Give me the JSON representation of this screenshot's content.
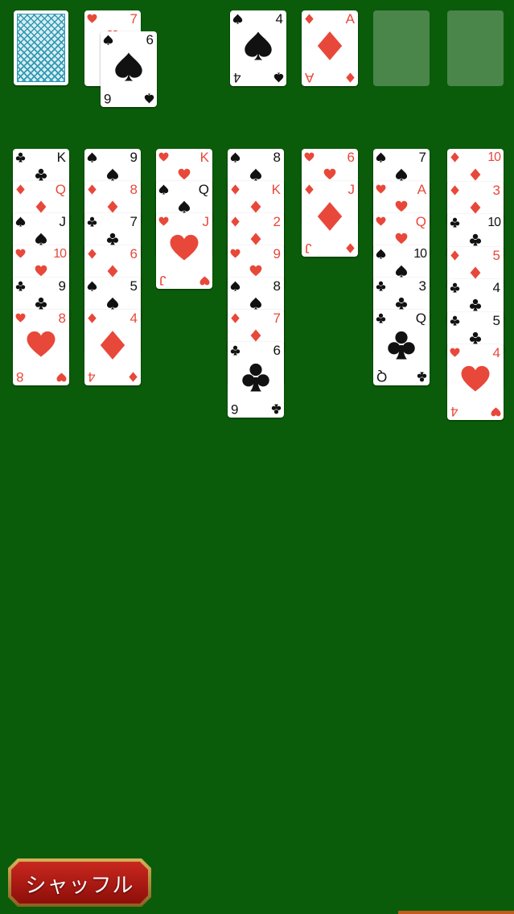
{
  "colors": {
    "felt": "#0a5c0a",
    "red_suit": "#e8483a",
    "black_suit": "#111111",
    "slot": "#4a854a"
  },
  "stock": {
    "face": "down"
  },
  "waste": [
    {
      "rank": "7",
      "suit": "hearts"
    },
    {
      "rank": "6",
      "suit": "spades"
    }
  ],
  "foundations": [
    {
      "rank": "4",
      "suit": "spades"
    },
    {
      "rank": "A",
      "suit": "diamonds"
    },
    null,
    null
  ],
  "tableau": [
    [
      {
        "rank": "K",
        "suit": "clubs"
      },
      {
        "rank": "Q",
        "suit": "diamonds"
      },
      {
        "rank": "J",
        "suit": "spades"
      },
      {
        "rank": "10",
        "suit": "hearts"
      },
      {
        "rank": "9",
        "suit": "clubs"
      },
      {
        "rank": "8",
        "suit": "hearts"
      }
    ],
    [
      {
        "rank": "9",
        "suit": "spades"
      },
      {
        "rank": "8",
        "suit": "diamonds"
      },
      {
        "rank": "7",
        "suit": "clubs"
      },
      {
        "rank": "6",
        "suit": "diamonds"
      },
      {
        "rank": "5",
        "suit": "spades"
      },
      {
        "rank": "4",
        "suit": "diamonds"
      }
    ],
    [
      {
        "rank": "K",
        "suit": "hearts"
      },
      {
        "rank": "Q",
        "suit": "spades"
      },
      {
        "rank": "J",
        "suit": "hearts"
      }
    ],
    [
      {
        "rank": "8",
        "suit": "spades"
      },
      {
        "rank": "K",
        "suit": "diamonds"
      },
      {
        "rank": "2",
        "suit": "diamonds"
      },
      {
        "rank": "9",
        "suit": "hearts"
      },
      {
        "rank": "8",
        "suit": "spades"
      },
      {
        "rank": "7",
        "suit": "diamonds"
      },
      {
        "rank": "6",
        "suit": "clubs"
      }
    ],
    [
      {
        "rank": "6",
        "suit": "hearts"
      },
      {
        "rank": "J",
        "suit": "diamonds"
      }
    ],
    [
      {
        "rank": "7",
        "suit": "spades"
      },
      {
        "rank": "A",
        "suit": "hearts"
      },
      {
        "rank": "Q",
        "suit": "hearts"
      },
      {
        "rank": "10",
        "suit": "spades"
      },
      {
        "rank": "3",
        "suit": "clubs"
      },
      {
        "rank": "Q",
        "suit": "clubs"
      }
    ],
    [
      {
        "rank": "10",
        "suit": "diamonds"
      },
      {
        "rank": "3",
        "suit": "diamonds"
      },
      {
        "rank": "10",
        "suit": "clubs"
      },
      {
        "rank": "5",
        "suit": "diamonds"
      },
      {
        "rank": "4",
        "suit": "clubs"
      },
      {
        "rank": "5",
        "suit": "clubs"
      },
      {
        "rank": "4",
        "suit": "hearts"
      }
    ]
  ],
  "shuffle_button": {
    "label": "シャッフル"
  }
}
